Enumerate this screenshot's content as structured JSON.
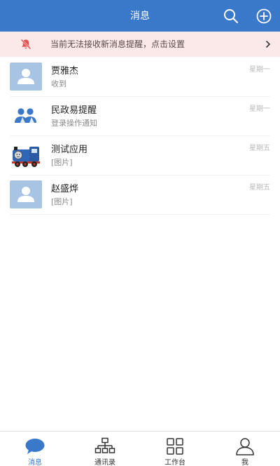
{
  "header": {
    "title": "消息",
    "icons": [
      "search-icon",
      "add-circle-icon"
    ]
  },
  "notice": {
    "text": "当前无法接收新消息提醒，点击设置",
    "icon": "bell-off-icon"
  },
  "conversations": [
    {
      "name": "贾雅杰",
      "preview": "收到",
      "time": "星期一",
      "avatar": "default-person-avatar"
    },
    {
      "name": "民政易提醒",
      "preview": "登录操作通知",
      "time": "星期一",
      "avatar": "group-people-icon"
    },
    {
      "name": "测试应用",
      "preview": "[图片]",
      "time": "星期五",
      "avatar": "train-app-avatar"
    },
    {
      "name": "赵盛烨",
      "preview": "[图片]",
      "time": "星期五",
      "avatar": "default-person-avatar"
    }
  ],
  "tabbar": {
    "active_index": 0,
    "tabs": [
      {
        "label": "消息",
        "icon": "chat-bubble-icon"
      },
      {
        "label": "通讯录",
        "icon": "org-chart-icon"
      },
      {
        "label": "工作台",
        "icon": "grid-icon"
      },
      {
        "label": "我",
        "icon": "person-icon"
      }
    ]
  },
  "colors": {
    "brand": "#3a78c9",
    "notice_bg": "#fbe9e9",
    "notice_icon": "#e0524f",
    "avatar_bg": "#a8c4e4"
  }
}
